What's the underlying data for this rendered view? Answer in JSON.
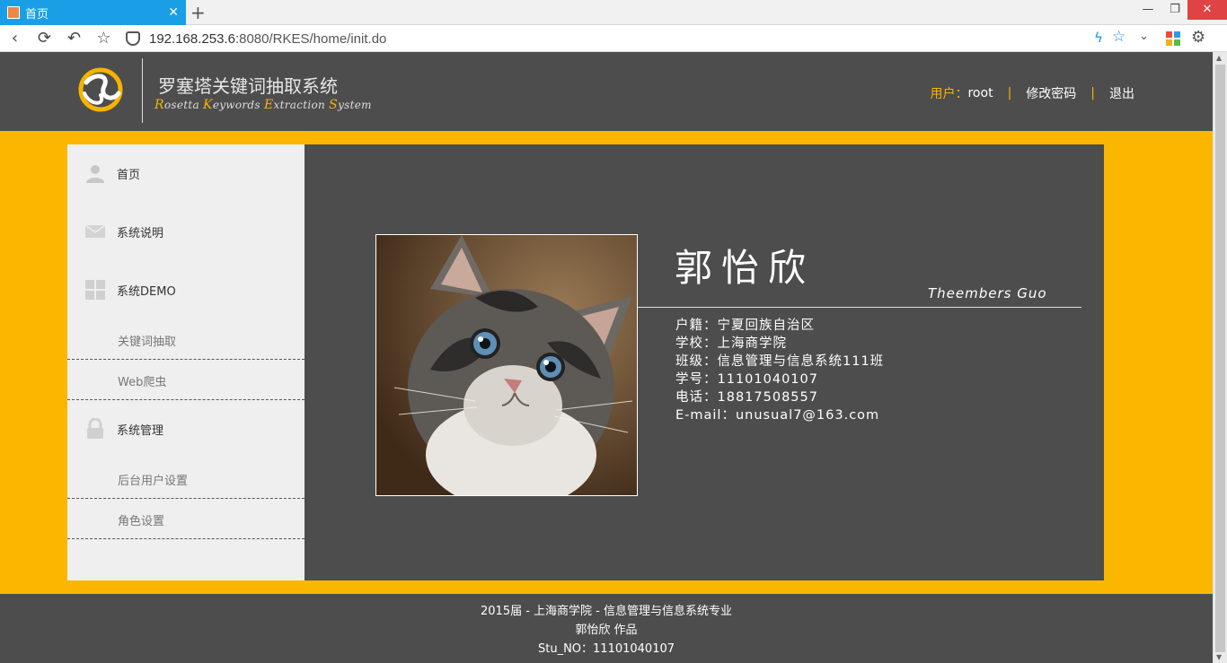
{
  "browser": {
    "tab_title": "首页",
    "url_host": "192.168.253.6",
    "url_rest": ":8080/RKES/home/init.do"
  },
  "header": {
    "title": "罗塞塔关键词抽取系统",
    "subtitle_parts": [
      {
        "hl": "R",
        "rest": "osetta "
      },
      {
        "hl": "K",
        "rest": "eywords "
      },
      {
        "hl": "E",
        "rest": "xtraction "
      },
      {
        "hl": "S",
        "rest": "ystem"
      }
    ],
    "user_label": "用户：",
    "user_name": "root",
    "change_password": "修改密码",
    "logout": "退出",
    "separator": "|",
    "accent_color": "#fbb700"
  },
  "sidebar": {
    "items": [
      {
        "label": "首页",
        "icon": "user-icon"
      },
      {
        "label": "系统说明",
        "icon": "mail-icon"
      },
      {
        "label": "系统DEMO",
        "icon": "grid-icon"
      },
      {
        "label": "关键词抽取"
      },
      {
        "label": "Web爬虫"
      },
      {
        "label": "系统管理",
        "icon": "lock-icon"
      },
      {
        "label": "后台用户设置"
      },
      {
        "label": "角色设置"
      }
    ]
  },
  "profile": {
    "name": "郭怡欣",
    "english_name": "Theembers Guo",
    "info": [
      "户籍：宁夏回族自治区",
      "学校：上海商学院",
      "班级：信息管理与信息系统111班",
      "学号：11101040107",
      "电话：18817508557",
      "E-mail：unusual7@163.com"
    ]
  },
  "footer": {
    "line1": "2015届 - 上海商学院 - 信息管理与信息系统专业",
    "line2": "郭怡欣 作品",
    "line3": "Stu_NO：11101040107"
  }
}
